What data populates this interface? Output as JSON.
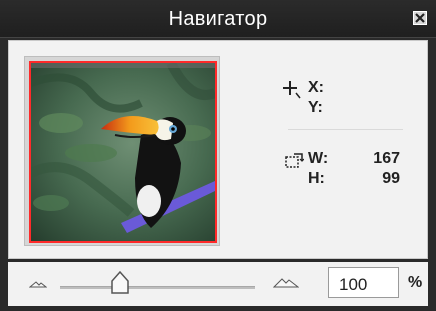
{
  "window": {
    "title": "Навигатор"
  },
  "cursor_info": {
    "x_label": "X:",
    "y_label": "Y:",
    "x_value": "",
    "y_value": ""
  },
  "size_info": {
    "w_label": "W:",
    "h_label": "H:",
    "w_value": "167",
    "h_value": "99"
  },
  "zoom": {
    "value": "100",
    "percent_label": "%",
    "slider_level_percent": 26
  },
  "icons": {
    "close": "close-icon",
    "crosshair": "crosshair-icon",
    "selection_size": "selection-size-icon",
    "zoom_out": "zoom-out-mountain-icon",
    "zoom_in": "zoom-in-mountain-icon"
  },
  "colors": {
    "titlebar": "#222222",
    "preview_frame": "#ff2a2a",
    "panel": "#f2f2f2"
  }
}
